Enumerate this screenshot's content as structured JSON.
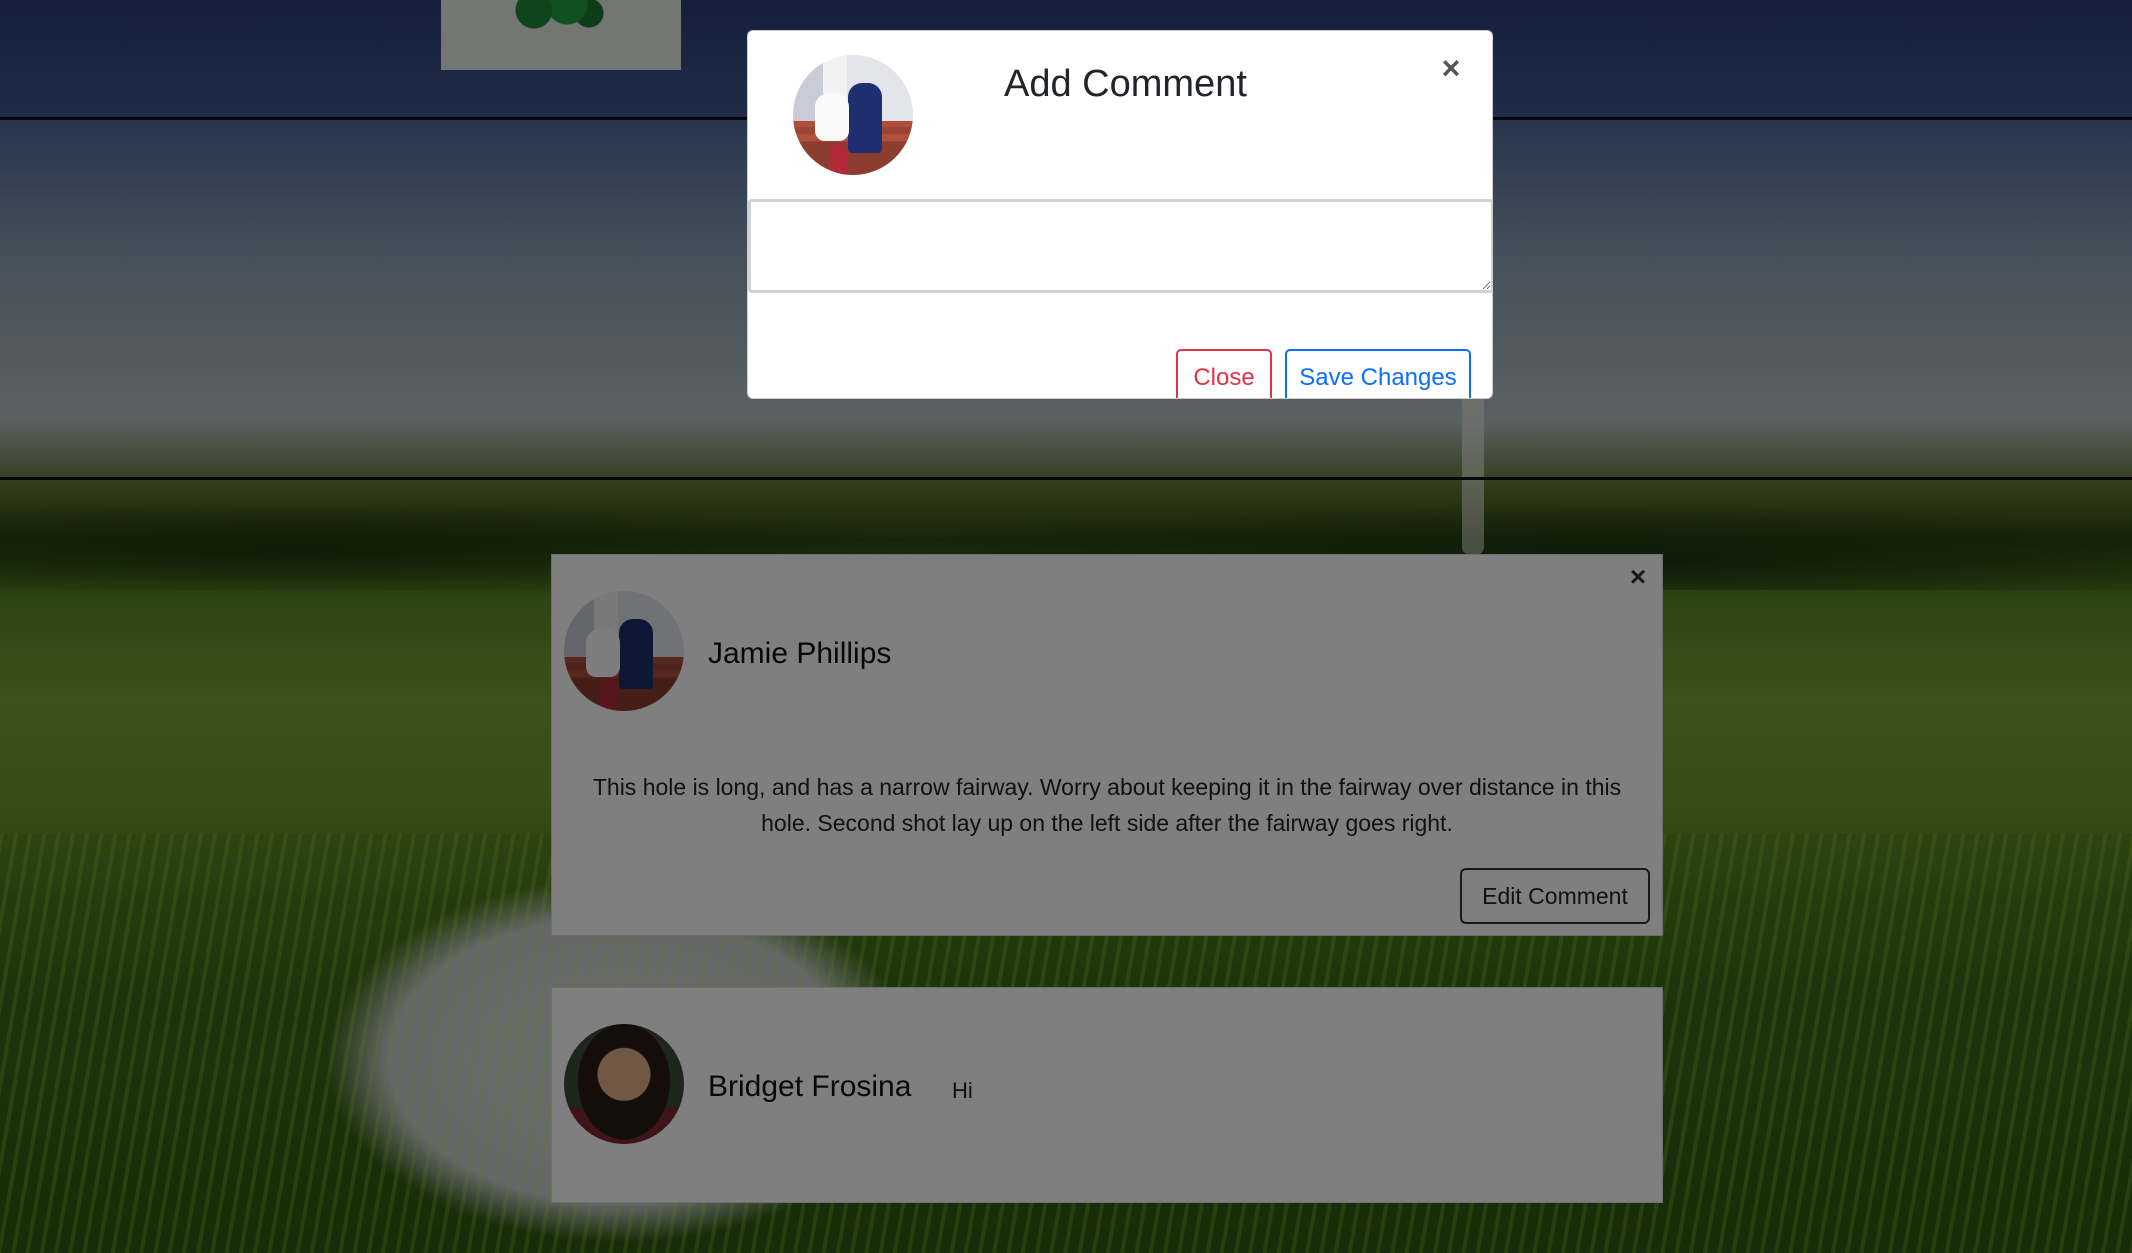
{
  "modal": {
    "title": "Add Comment",
    "close_icon": "×",
    "textarea_value": "",
    "buttons": {
      "close_label": "Close",
      "save_label": "Save Changes"
    },
    "colors": {
      "close": "#dc3545",
      "save": "#0d6efd"
    }
  },
  "comments": [
    {
      "author": "Jamie Phillips",
      "text": "This hole is long, and has a narrow fairway. Worry about keeping it in the fairway over distance in this hole. Second shot lay up on the left side after the fairway goes right.",
      "delete_icon": "×",
      "edit_label": "Edit Comment"
    },
    {
      "author": "Bridget Frosina",
      "text": "Hi"
    }
  ],
  "icons": {
    "modal_close": "close-icon",
    "comment_delete": "close-icon",
    "logo": "clover-logo"
  }
}
